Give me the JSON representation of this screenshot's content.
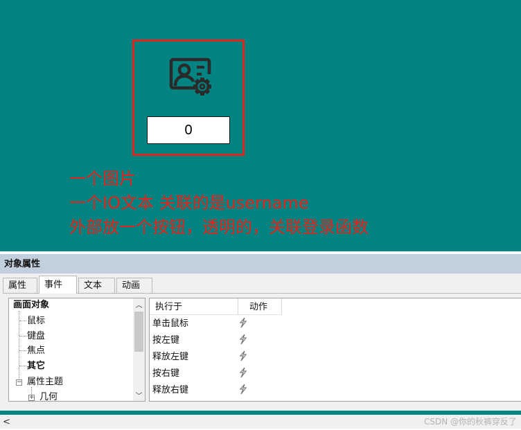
{
  "canvas": {
    "io_field_value": "0",
    "icon": "user-settings-icon",
    "notes": [
      "一个图片",
      "一个IO文本 关联的是username",
      "外部放一个按钮，透明的，关联登录函数"
    ],
    "colors": {
      "background": "#038482",
      "annotation": "#e3221a"
    }
  },
  "panel": {
    "title": "对象属性",
    "tabs": [
      {
        "label": "属性",
        "active": false
      },
      {
        "label": "事件",
        "active": true
      },
      {
        "label": "文本",
        "active": false
      },
      {
        "label": "动画",
        "active": false
      }
    ],
    "tree": [
      {
        "label": "画面对象",
        "bold": true
      },
      {
        "label": "鼠标",
        "bold": false
      },
      {
        "label": "键盘",
        "bold": false
      },
      {
        "label": "焦点",
        "bold": false
      },
      {
        "label": "其它",
        "bold": true
      },
      {
        "label": "属性主题",
        "bold": false
      },
      {
        "label": "几何",
        "bold": false
      }
    ],
    "events_columns": [
      "执行于",
      "动作"
    ],
    "events_rows": [
      "单击鼠标",
      "按左键",
      "释放左键",
      "按右键",
      "释放右键"
    ],
    "action_icon": "lightning-icon"
  },
  "watermark": "CSDN @你的秋裤穿反了"
}
